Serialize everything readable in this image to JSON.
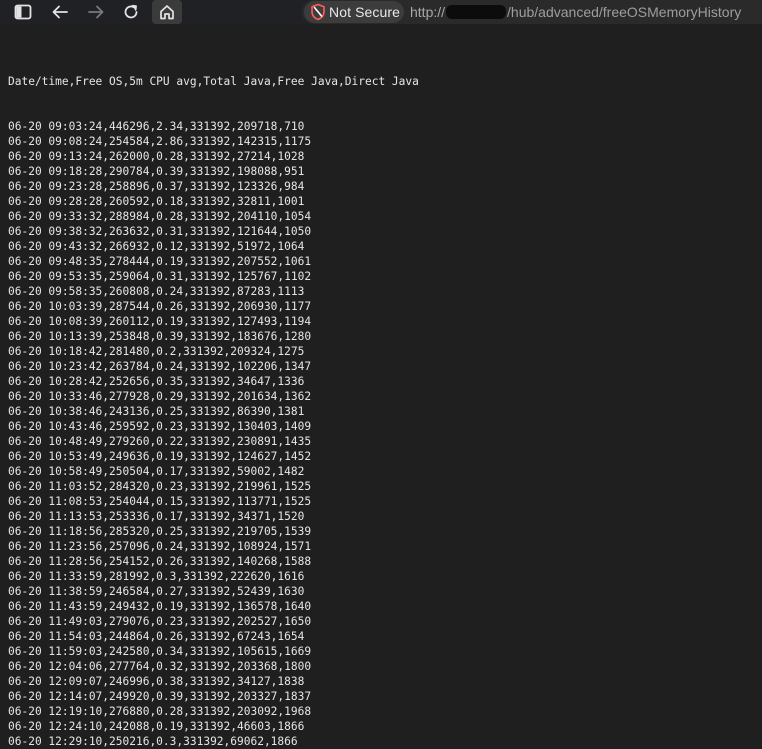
{
  "toolbar": {
    "icons": [
      "sidebar-icon",
      "back-arrow-icon",
      "forward-arrow-icon",
      "reload-icon",
      "home-icon",
      "shield-warning-icon"
    ],
    "security_label": "Not Secure",
    "url_prefix": "http://",
    "url_path": "/hub/advanced/freeOSMemoryHistory"
  },
  "document": {
    "header": "Date/time,Free OS,5m CPU avg,Total Java,Free Java,Direct Java",
    "lines": [
      "06-20 09:03:24,446296,2.34,331392,209718,710",
      "06-20 09:08:24,254584,2.86,331392,142315,1175",
      "06-20 09:13:24,262000,0.28,331392,27214,1028",
      "06-20 09:18:28,290784,0.39,331392,198088,951",
      "06-20 09:23:28,258896,0.37,331392,123326,984",
      "06-20 09:28:28,260592,0.18,331392,32811,1001",
      "06-20 09:33:32,288984,0.28,331392,204110,1054",
      "06-20 09:38:32,263632,0.31,331392,121644,1050",
      "06-20 09:43:32,266932,0.12,331392,51972,1064",
      "06-20 09:48:35,278444,0.19,331392,207552,1061",
      "06-20 09:53:35,259064,0.31,331392,125767,1102",
      "06-20 09:58:35,260808,0.24,331392,87283,1113",
      "06-20 10:03:39,287544,0.26,331392,206930,1177",
      "06-20 10:08:39,260112,0.19,331392,127493,1194",
      "06-20 10:13:39,253848,0.39,331392,183676,1280",
      "06-20 10:18:42,281480,0.2,331392,209324,1275",
      "06-20 10:23:42,263784,0.24,331392,102206,1347",
      "06-20 10:28:42,252656,0.35,331392,34647,1336",
      "06-20 10:33:46,277928,0.29,331392,201634,1362",
      "06-20 10:38:46,243136,0.25,331392,86390,1381",
      "06-20 10:43:46,259592,0.23,331392,130403,1409",
      "06-20 10:48:49,279260,0.22,331392,230891,1435",
      "06-20 10:53:49,249636,0.19,331392,124627,1452",
      "06-20 10:58:49,250504,0.17,331392,59002,1482",
      "06-20 11:03:52,284320,0.23,331392,219961,1525",
      "06-20 11:08:53,254044,0.15,331392,113771,1525",
      "06-20 11:13:53,253336,0.17,331392,34371,1520",
      "06-20 11:18:56,285320,0.25,331392,219705,1539",
      "06-20 11:23:56,257096,0.24,331392,108924,1571",
      "06-20 11:28:56,254152,0.26,331392,140268,1588",
      "06-20 11:33:59,281992,0.3,331392,222620,1616",
      "06-20 11:38:59,246584,0.27,331392,52439,1630",
      "06-20 11:43:59,249432,0.19,331392,136578,1640",
      "06-20 11:49:03,279076,0.23,331392,202527,1650",
      "06-20 11:54:03,244864,0.26,331392,67243,1654",
      "06-20 11:59:03,242580,0.34,331392,105615,1669",
      "06-20 12:04:06,277764,0.32,331392,203368,1800",
      "06-20 12:09:07,246996,0.38,331392,34127,1838",
      "06-20 12:14:07,249920,0.39,331392,203327,1837",
      "06-20 12:19:10,276880,0.28,331392,203092,1968",
      "06-20 12:24:10,242088,0.19,331392,46603,1866",
      "06-20 12:29:10,250216,0.3,331392,69062,1866"
    ]
  }
}
